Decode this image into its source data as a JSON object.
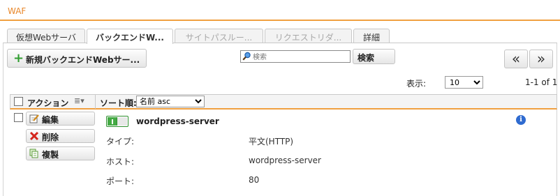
{
  "app": {
    "title": "WAF"
  },
  "tabs": [
    {
      "label": "仮想Webサーバ",
      "state": "normal"
    },
    {
      "label": "バックエンドW...",
      "state": "active"
    },
    {
      "label": "サイトパスルー...",
      "state": "disabled"
    },
    {
      "label": "リクエストリダ...",
      "state": "disabled"
    },
    {
      "label": "詳細",
      "state": "normal"
    }
  ],
  "toolbar": {
    "new_button_label": "新規バックエンドWebサー...",
    "search_placeholder": "検索",
    "search_button_label": "検索",
    "first_page_label": "«",
    "next_page_label": "»"
  },
  "pagination": {
    "display_label": "表示:",
    "per_page_value": "10",
    "per_page_options": [
      "10"
    ],
    "range_text": "1-1 of 1"
  },
  "list_header": {
    "action_label": "アクション",
    "sort_label": "ソート順:",
    "sort_value": "名前 asc",
    "sort_options": [
      "名前 asc"
    ]
  },
  "row": {
    "edit_label": "編集",
    "delete_label": "削除",
    "clone_label": "複製",
    "enabled": true,
    "name": "wordpress-server",
    "fields": [
      {
        "label": "タイプ:",
        "value": "平文(HTTP)"
      },
      {
        "label": "ホスト:",
        "value": "wordpress-server"
      },
      {
        "label": "ポート:",
        "value": "80"
      }
    ]
  },
  "colors": {
    "accent": "#f0a040",
    "title": "#e8872a",
    "toggle_on": "#44aa44",
    "info": "#2f6bd0"
  }
}
